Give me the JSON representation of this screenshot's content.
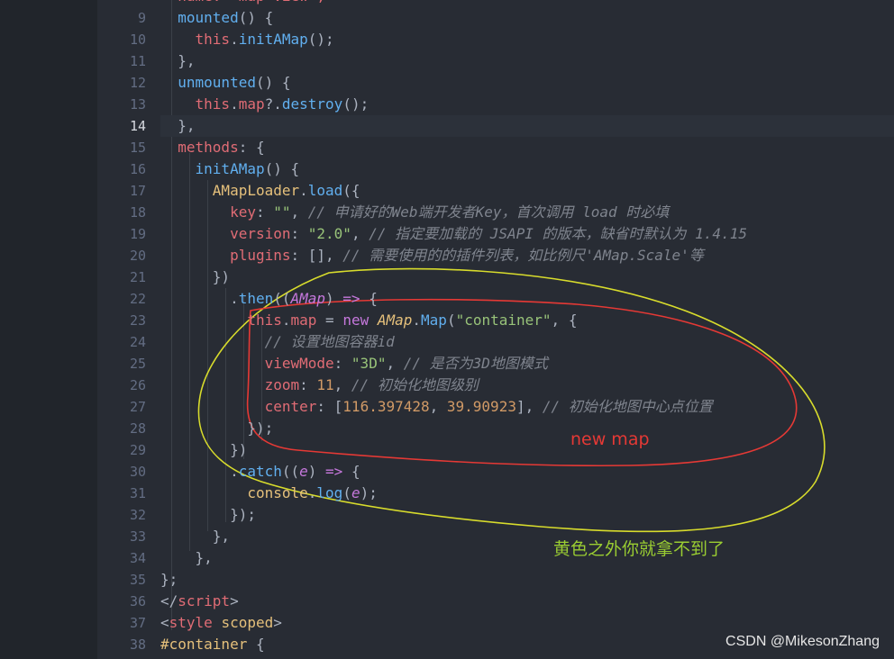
{
  "editor": {
    "line_numbers": [
      "9",
      "10",
      "11",
      "12",
      "13",
      "14",
      "15",
      "16",
      "17",
      "18",
      "19",
      "20",
      "21",
      "22",
      "23",
      "24",
      "25",
      "26",
      "27",
      "28",
      "29",
      "30",
      "31",
      "32",
      "33",
      "34",
      "35",
      "36",
      "37",
      "38"
    ],
    "active_line": "14",
    "lines": {
      "l8": "  name: \"map-view\",",
      "l9": [
        [
          "  ",
          "p"
        ],
        [
          "mounted",
          "f"
        ],
        [
          "() {",
          "b"
        ]
      ],
      "l10": [
        [
          "    this",
          "r"
        ],
        [
          ".",
          "p"
        ],
        [
          "initAMap",
          "f"
        ],
        [
          "();",
          "p"
        ]
      ],
      "l11": [
        [
          "  },",
          "p"
        ]
      ],
      "l12": [
        [
          "  ",
          "p"
        ],
        [
          "unmounted",
          "f"
        ],
        [
          "() {",
          "b"
        ]
      ],
      "l13": [
        [
          "    this",
          "r"
        ],
        [
          ".",
          "p"
        ],
        [
          "map",
          "r"
        ],
        [
          "?.",
          "p"
        ],
        [
          "destroy",
          "f"
        ],
        [
          "();",
          "p"
        ]
      ],
      "l14": [
        [
          "  },",
          "p"
        ]
      ],
      "l15": [
        [
          "  methods",
          "r"
        ],
        [
          ": {",
          "p"
        ]
      ],
      "l16": [
        [
          "    ",
          "p"
        ],
        [
          "initAMap",
          "f"
        ],
        [
          "() {",
          "p"
        ]
      ],
      "l17": [
        [
          "      AMapLoader",
          "y"
        ],
        [
          ".",
          "p"
        ],
        [
          "load",
          "f"
        ],
        [
          "({",
          "p"
        ]
      ],
      "l18": [
        [
          "        key",
          "r"
        ],
        [
          ": ",
          "p"
        ],
        [
          "\"\"",
          "s"
        ],
        [
          ", ",
          "p"
        ],
        [
          "// 申请好的Web端开发者Key，首次调用 load 时必填",
          "c"
        ]
      ],
      "l19": [
        [
          "        version",
          "r"
        ],
        [
          ": ",
          "p"
        ],
        [
          "\"2.0\"",
          "s"
        ],
        [
          ", ",
          "p"
        ],
        [
          "// 指定要加载的 JSAPI 的版本，缺省时默认为 1.4.15",
          "c"
        ]
      ],
      "l20": [
        [
          "        plugins",
          "r"
        ],
        [
          ": [], ",
          "p"
        ],
        [
          "// 需要使用的的插件列表，如比例尺'AMap.Scale'等",
          "c"
        ]
      ],
      "l21": [
        [
          "      })",
          "p"
        ]
      ],
      "l22": [
        [
          "        .",
          "p"
        ],
        [
          "then",
          "f"
        ],
        [
          "((",
          "p"
        ],
        [
          "AMap",
          "pi"
        ],
        [
          ") ",
          "p"
        ],
        [
          "=>",
          "k"
        ],
        [
          " {",
          "p"
        ]
      ],
      "l23": [
        [
          "          this",
          "r"
        ],
        [
          ".",
          "p"
        ],
        [
          "map",
          "r"
        ],
        [
          " = ",
          "p"
        ],
        [
          "new",
          "k"
        ],
        [
          " ",
          "p"
        ],
        [
          "AMap",
          "ci"
        ],
        [
          ".",
          "p"
        ],
        [
          "Map",
          "f"
        ],
        [
          "(",
          "p"
        ],
        [
          "\"container\"",
          "s"
        ],
        [
          ", {",
          "p"
        ]
      ],
      "l24": [
        [
          "            // 设置地图容器id",
          "c"
        ]
      ],
      "l25": [
        [
          "            viewMode",
          "r"
        ],
        [
          ": ",
          "p"
        ],
        [
          "\"3D\"",
          "s"
        ],
        [
          ", ",
          "p"
        ],
        [
          "// 是否为3D地图模式",
          "c"
        ]
      ],
      "l26": [
        [
          "            zoom",
          "r"
        ],
        [
          ": ",
          "p"
        ],
        [
          "11",
          "n"
        ],
        [
          ", ",
          "p"
        ],
        [
          "// 初始化地图级别",
          "c"
        ]
      ],
      "l27": [
        [
          "            center",
          "r"
        ],
        [
          ": [",
          "p"
        ],
        [
          "116.397428",
          "n"
        ],
        [
          ", ",
          "p"
        ],
        [
          "39.90923",
          "n"
        ],
        [
          "], ",
          "p"
        ],
        [
          "// 初始化地图中心点位置",
          "c"
        ]
      ],
      "l28": [
        [
          "          });",
          "p"
        ]
      ],
      "l29": [
        [
          "        })",
          "p"
        ]
      ],
      "l30": [
        [
          "        .",
          "p"
        ],
        [
          "catch",
          "f"
        ],
        [
          "((",
          "p"
        ],
        [
          "e",
          "pi"
        ],
        [
          ") ",
          "p"
        ],
        [
          "=>",
          "k"
        ],
        [
          " {",
          "p"
        ]
      ],
      "l31": [
        [
          "          console",
          "y"
        ],
        [
          ".",
          "p"
        ],
        [
          "log",
          "f"
        ],
        [
          "(",
          "p"
        ],
        [
          "e",
          "pi"
        ],
        [
          ");",
          "p"
        ]
      ],
      "l32": [
        [
          "        });",
          "p"
        ]
      ],
      "l33": [
        [
          "      },",
          "p"
        ]
      ],
      "l34": [
        [
          "    },",
          "p"
        ]
      ],
      "l35": [
        [
          "};",
          "p"
        ]
      ],
      "l36": [
        [
          "</",
          "p"
        ],
        [
          "script",
          "r"
        ],
        [
          ">",
          "p"
        ]
      ],
      "l37": [
        [
          "<",
          "p"
        ],
        [
          "style",
          "r"
        ],
        [
          " ",
          "p"
        ],
        [
          "scoped",
          "y"
        ],
        [
          ">",
          "p"
        ]
      ],
      "l38": [
        [
          "#container",
          "y"
        ],
        [
          " {",
          "p"
        ]
      ]
    }
  },
  "annotations": {
    "red_label": "new map",
    "yellow_label": "黄色之外你就拿不到了",
    "red_color": "#e53935",
    "yellow_color": "#d8dc2c",
    "label_yellow_color": "#9acd32"
  },
  "watermark": "CSDN @MikesonZhang"
}
